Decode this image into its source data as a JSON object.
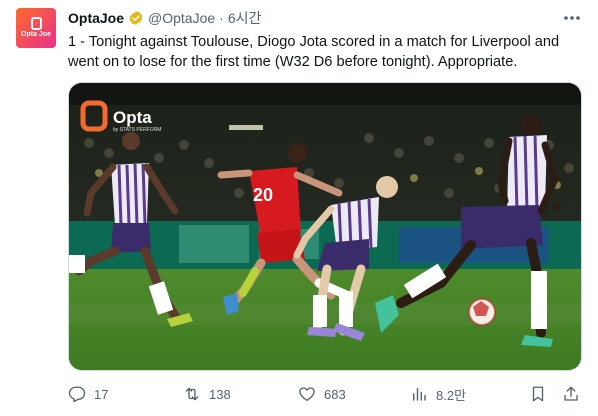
{
  "author": {
    "avatar_text": "Opta Joe",
    "display_name": "OptaJoe",
    "handle": "@OptaJoe",
    "separator": "·",
    "time": "6시간"
  },
  "tweet": {
    "text": "1 - Tonight against Toulouse, Diogo Jota scored in a match for Liverpool and went on to lose for the first time (W32 D6 before tonight). Appropriate."
  },
  "media": {
    "watermark_brand": "Opta",
    "watermark_sub": "by STATS PERFORM",
    "jersey_number": "20"
  },
  "actions": {
    "replies": "17",
    "retweets": "138",
    "likes": "683",
    "views": "8.2만"
  },
  "colors": {
    "verified_badge": "#e2b719",
    "text_primary": "#0f1419",
    "text_secondary": "#536471",
    "liverpool_red": "#d71920",
    "toulouse_purple": "#5b3a8e"
  }
}
